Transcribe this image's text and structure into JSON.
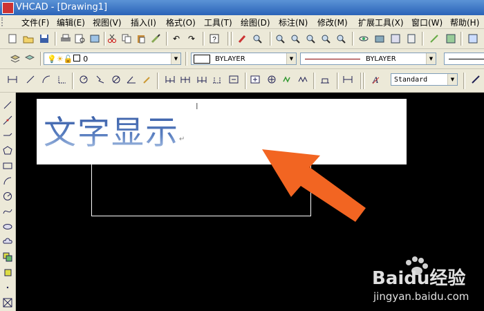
{
  "window": {
    "title": "VHCAD - [Drawing1]"
  },
  "menu": [
    "文件(F)",
    "编辑(E)",
    "视图(V)",
    "插入(I)",
    "格式(O)",
    "工具(T)",
    "绘图(D)",
    "标注(N)",
    "修改(M)",
    "扩展工具(X)",
    "窗口(W)",
    "帮助(H)"
  ],
  "layer": {
    "name": "0"
  },
  "color": {
    "value": "BYLAYER"
  },
  "linetype": {
    "value": "BYLAYER"
  },
  "textstyle": {
    "value": "Standard"
  },
  "canvas": {
    "text": "文字显示",
    "paragraph_mark": "↵",
    "cursor_mark": "Ι"
  },
  "watermark": {
    "logo": "Baidu经验",
    "url": "jingyan.baidu.com"
  },
  "colors": {
    "arrow": "#f26522",
    "text_gradient_top": "#3a5fa8",
    "text_gradient_bottom": "#b8cdea"
  },
  "icons": {
    "toolbar1": [
      "new-icon",
      "open-icon",
      "save-icon",
      "print-icon",
      "preview-icon",
      "publish-icon",
      "cut-icon",
      "copy-icon",
      "paste-icon",
      "match-properties-icon",
      "undo-icon",
      "redo-icon",
      "help-icon",
      "pan-icon",
      "zoom-realtime-icon",
      "zoom-window-icon",
      "zoom-previous-icon",
      "zoom-in-icon",
      "zoom-out-icon",
      "zoom-all-icon",
      "zoom-extents-icon",
      "3d-orbit-icon",
      "named-views-icon",
      "design-center-icon",
      "tool-palette-icon",
      "properties-icon",
      "block-editor-icon",
      "markup-icon",
      "external-ref-icon"
    ],
    "toolbar3": [
      "linear-dim-icon",
      "aligned-dim-icon",
      "arc-length-icon",
      "ordinate-dim-icon",
      "radius-dim-icon",
      "jogged-dim-icon",
      "diameter-dim-icon",
      "angular-dim-icon",
      "quick-dim-icon",
      "baseline-dim-icon",
      "continue-dim-icon",
      "quick-leader-icon",
      "tolerance-icon",
      "center-mark-icon",
      "dim-edit-icon",
      "dim-text-edit-icon",
      "dim-update-icon",
      "dim-style-icon"
    ],
    "draw": [
      "line-icon",
      "construction-line-icon",
      "polyline-icon",
      "polygon-icon",
      "rectangle-icon",
      "arc-icon",
      "circle-icon",
      "spline-icon",
      "ellipse-icon",
      "revision-cloud-icon",
      "insert-block-icon",
      "make-block-icon",
      "point-icon",
      "hatch-icon"
    ]
  }
}
